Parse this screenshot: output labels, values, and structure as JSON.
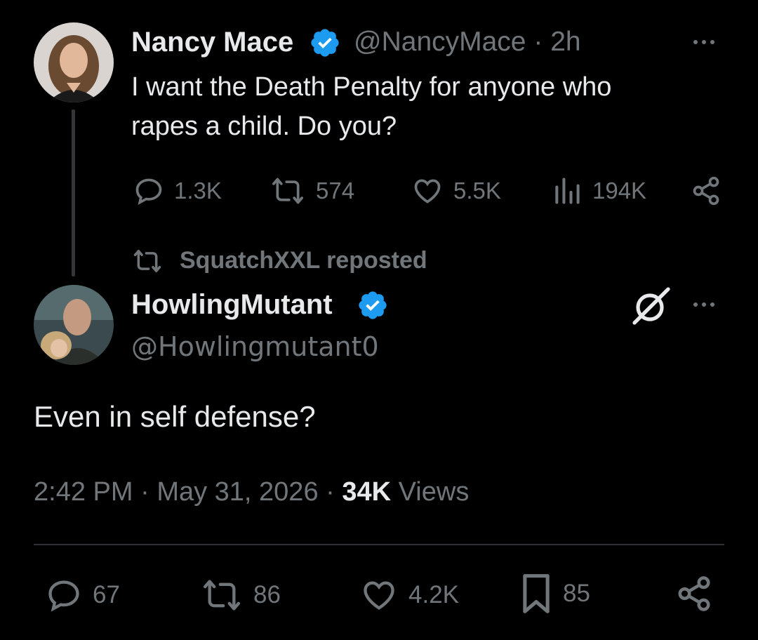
{
  "quoted_tweet": {
    "author_name": "Nancy Mace",
    "handle": "@NancyMace",
    "separator": "·",
    "time": "2h",
    "text_line1": "I want the Death Penalty for anyone who",
    "text_line2": "rapes a child. Do you?",
    "stats": {
      "replies": "1.3K",
      "reposts": "574",
      "likes": "5.5K",
      "views": "194K"
    }
  },
  "repost_note": "SquatchXXL reposted",
  "main_tweet": {
    "author_name": "HowlingMutant",
    "handle": "@Howlingmutant0",
    "text": "Even in self defense?",
    "time": "2:42 PM",
    "date": "May 31, 2026",
    "separator": "·",
    "views_count": "34K",
    "views_label": "Views",
    "stats": {
      "replies": "67",
      "reposts": "86",
      "likes": "4.2K",
      "bookmarks": "85"
    }
  },
  "colors": {
    "background": "#000000",
    "text": "#e7e9ea",
    "muted": "#71767b",
    "verified_blue": "#1d9bf0",
    "divider": "#2f3336"
  },
  "icons": [
    "reply-icon",
    "repost-icon",
    "like-icon",
    "views-icon",
    "share-icon",
    "bookmark-icon",
    "verified-badge-icon",
    "grok-icon",
    "more-icon"
  ]
}
